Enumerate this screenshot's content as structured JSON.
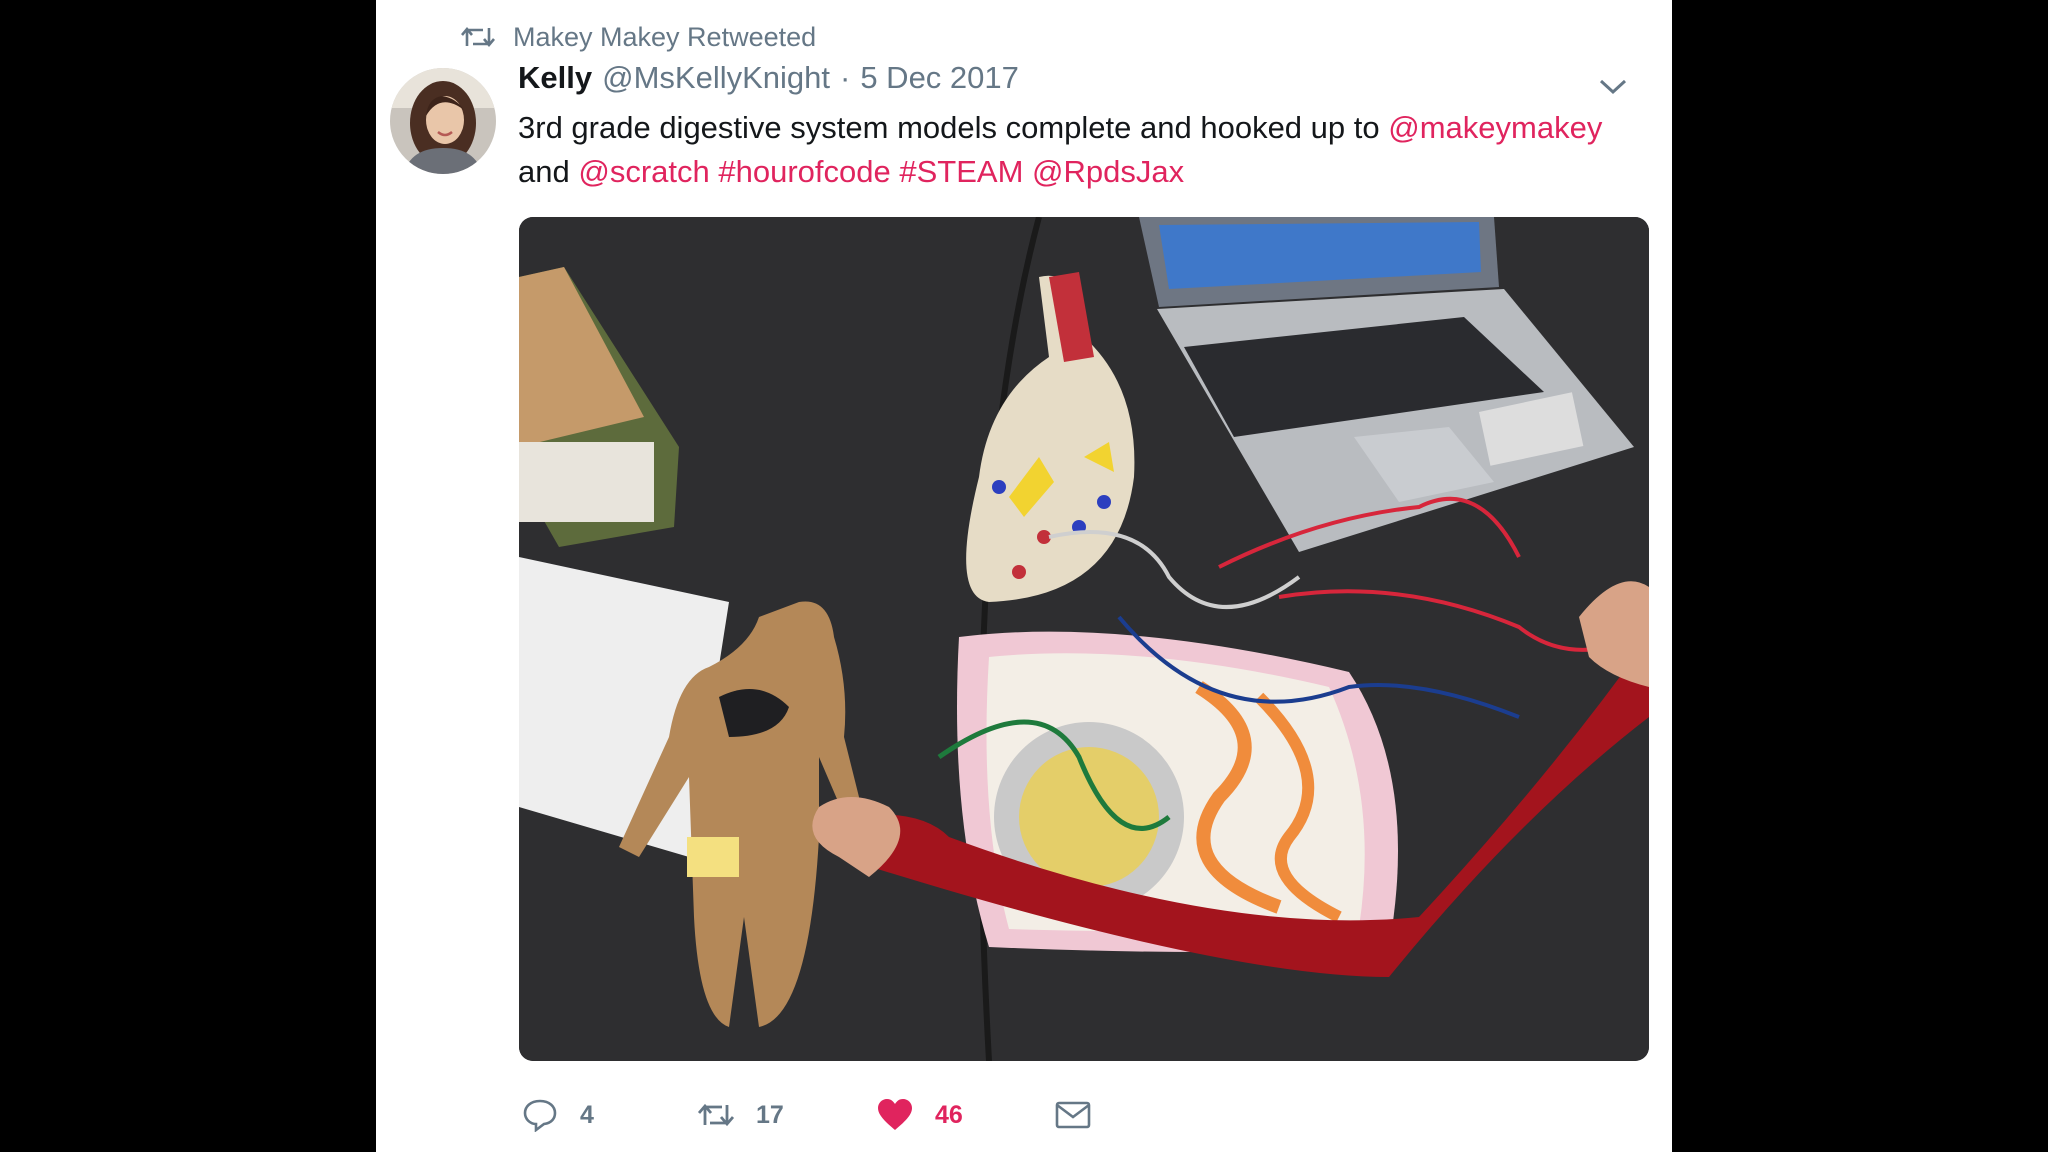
{
  "retweet_header": {
    "text": "Makey Makey Retweeted"
  },
  "tweet": {
    "author_name": "Kelly",
    "author_handle": "@MsKellyKnight",
    "separator": "·",
    "date": "5 Dec 2017",
    "text_segments": [
      {
        "text": "3rd grade digestive system models complete and hooked up to ",
        "link": false
      },
      {
        "text": "@makeymakey",
        "link": true
      },
      {
        "text": " and ",
        "link": false
      },
      {
        "text": "@scratch",
        "link": true
      },
      {
        "text": " ",
        "link": false
      },
      {
        "text": "#hourofcode",
        "link": true
      },
      {
        "text": " ",
        "link": false
      },
      {
        "text": "#STEAM",
        "link": true
      },
      {
        "text": " ",
        "link": false
      },
      {
        "text": "@RpdsJax",
        "link": true
      }
    ]
  },
  "actions": {
    "replies": "4",
    "retweets": "17",
    "likes": "46"
  },
  "icons": {
    "retweet": "retweet-icon",
    "reply": "reply-icon",
    "like": "heart-icon",
    "message": "envelope-icon",
    "menu": "chevron-down-icon"
  },
  "colors": {
    "link": "#e0245e",
    "like": "#e0245e",
    "muted": "#657786",
    "text": "#14171a"
  }
}
